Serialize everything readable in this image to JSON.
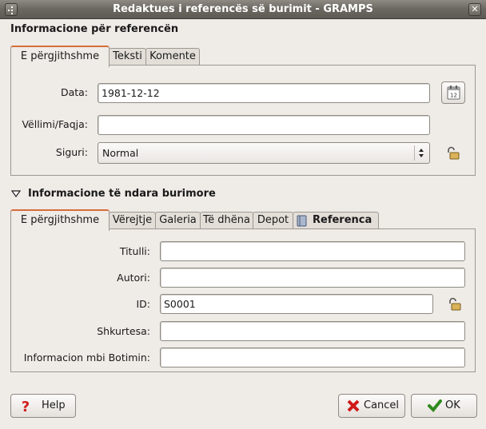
{
  "window": {
    "title": "Redaktues i referencës së burimit - GRAMPS"
  },
  "reference_section": {
    "heading": "Informacione për referencën",
    "tabs": [
      {
        "label": "E përgjithshme",
        "active": true
      },
      {
        "label": "Teksti",
        "active": false
      },
      {
        "label": "Komente",
        "active": false
      }
    ],
    "fields": {
      "date_label": "Data:",
      "date_value": "1981-12-12",
      "volume_label": "Vëllimi/Faqja:",
      "volume_value": "",
      "confidence_label": "Siguri:",
      "confidence_value": "Normal"
    }
  },
  "source_section": {
    "heading": "Informacione të ndara burimore",
    "tabs": [
      {
        "label": "E përgjithshme",
        "active": true
      },
      {
        "label": "Vërejtje",
        "active": false
      },
      {
        "label": "Galeria",
        "active": false
      },
      {
        "label": "Të dhëna",
        "active": false
      },
      {
        "label": "Depot",
        "active": false
      },
      {
        "label": "Referenca",
        "active": false
      }
    ],
    "fields": {
      "title_label": "Titulli:",
      "title_value": "",
      "author_label": "Autori:",
      "author_value": "",
      "id_label": "ID:",
      "id_value": "S0001",
      "abbrev_label": "Shkurtesa:",
      "abbrev_value": "",
      "pubinfo_label": "Informacion mbi Botimin:",
      "pubinfo_value": ""
    }
  },
  "buttons": {
    "help": "Help",
    "cancel": "Cancel",
    "ok": "OK"
  },
  "icons": {
    "calendar": "calendar-icon",
    "lock": "padlock-open-icon",
    "help": "question-mark-icon",
    "cancel": "red-x-icon",
    "ok": "green-check-icon"
  },
  "colors": {
    "accent_tab": "#d56e3a",
    "titlebar": "#6b6761",
    "background": "#efebe7"
  }
}
